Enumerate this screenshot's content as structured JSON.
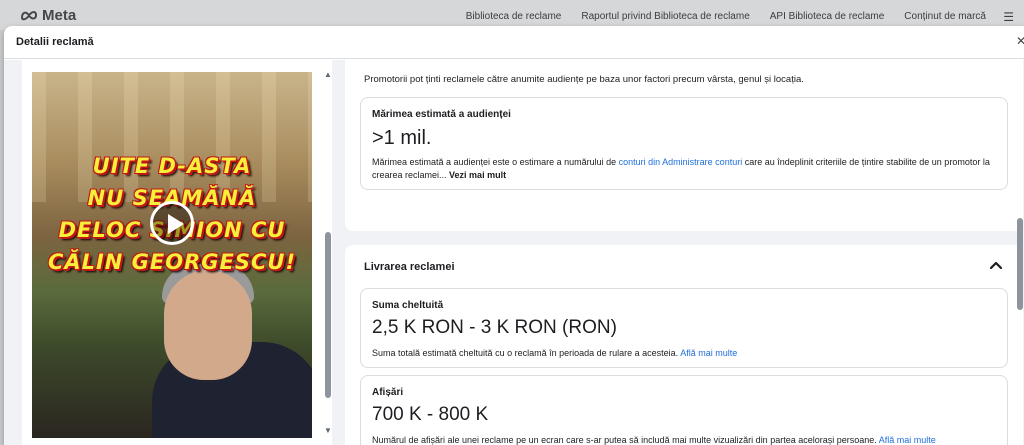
{
  "topbar": {
    "logo_text": "Meta",
    "nav": [
      "Biblioteca de reclame",
      "Raportul privind Biblioteca de reclame",
      "API Biblioteca de reclame",
      "Conținut de marcă"
    ]
  },
  "modal": {
    "title": "Detalii reclamă"
  },
  "media": {
    "caption_lines": [
      "UITE D-ASTA",
      "NU SEAMĂNĂ",
      "DELOC SIMION CU",
      "CĂLIN GEORGESCU!"
    ]
  },
  "audience": {
    "intro": "Promotorii pot ținti reclamele către anumite audiențe pe baza unor factori precum vârsta, genul și locația.",
    "label": "Mărimea estimată a audienței",
    "value": ">1 mil.",
    "desc_before": "Mărimea estimată a audienței este o estimare a numărului de ",
    "desc_link": "conturi din Administrare conturi",
    "desc_after": " care au îndeplinit criteriile de țintire stabilite de un promotor la crearea reclamei...",
    "more_link": "Vezi mai mult"
  },
  "delivery": {
    "title": "Livrarea reclamei",
    "spend": {
      "label": "Suma cheltuită",
      "value": "2,5 K RON - 3 K RON (RON)",
      "desc": "Suma totală estimată cheltuită cu o reclamă în perioada de rulare a acesteia.",
      "link": "Află mai multe"
    },
    "impressions": {
      "label": "Afișări",
      "value": "700 K - 800 K",
      "desc": "Numărul de afișări ale unei reclame pe un ecran care s-ar putea să includă mai multe vizualizări din partea acelorași persoane.",
      "link": "Află mai multe"
    }
  },
  "colors": {
    "link": "#216fdb",
    "caption_fill": "#f7ef3a",
    "caption_outline": "#c01616"
  }
}
